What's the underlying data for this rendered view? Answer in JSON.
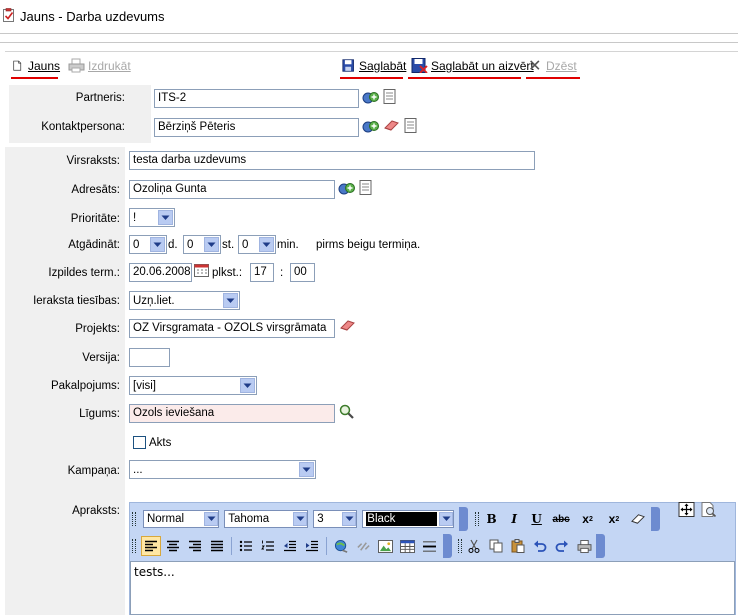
{
  "window": {
    "title": "Jauns - Darba uzdevums"
  },
  "toolbar": {
    "new_label": "Jauns",
    "print_label": "Izdrukāt",
    "save_label": "Saglabāt",
    "save_close_label": "Saglabāt un aizvērt",
    "delete_label": "Dzēst"
  },
  "partner_panel": {
    "partner_label": "Partneris:",
    "partner_value": "ITS-2",
    "contact_label": "Kontaktpersona:",
    "contact_value": "Bērziņš Pēteris"
  },
  "form": {
    "subject_label": "Virsraksts:",
    "subject_value": "testa darba uzdevums",
    "addressee_label": "Adresāts:",
    "addressee_value": "Ozoliņa Gunta",
    "priority_label": "Prioritāte:",
    "priority_value": "!",
    "reminder_label": "Atgādināt:",
    "reminder_days": "0",
    "reminder_days_unit": "d.",
    "reminder_hours": "0",
    "reminder_hours_unit": "st.",
    "reminder_minutes": "0",
    "reminder_minutes_unit": "min.",
    "reminder_suffix": "pirms beigu termiņa.",
    "due_label": "Izpildes term.:",
    "due_date": "20.06.2008",
    "due_time_label": "plkst.:",
    "due_hour": "17",
    "due_sep": ":",
    "due_minute": "00",
    "rights_label": "Ieraksta tiesības:",
    "rights_value": "Uzņ.liet.",
    "project_label": "Projekts:",
    "project_value": "OZ Virsgramata - OZOLS virsgrāmata",
    "version_label": "Versija:",
    "version_value": "",
    "service_label": "Pakalpojums:",
    "service_value": "[visi]",
    "contract_label": "Līgums:",
    "contract_value": "Ozols ieviešana",
    "acts_label": "Akts",
    "acts_checked": false,
    "campaign_label": "Kampaņa:",
    "campaign_value": "...",
    "description_label": "Apraksts:"
  },
  "editor": {
    "style_value": "Normal",
    "font_value": "Tahoma",
    "size_value": "3",
    "color_value": "Black",
    "content": "tests..."
  },
  "colors": {
    "accent_underline": "#e00000",
    "panel_bg": "#f0f0f0",
    "editor_toolbar": "#c4d6f4",
    "contract_bg": "#fbebea"
  }
}
